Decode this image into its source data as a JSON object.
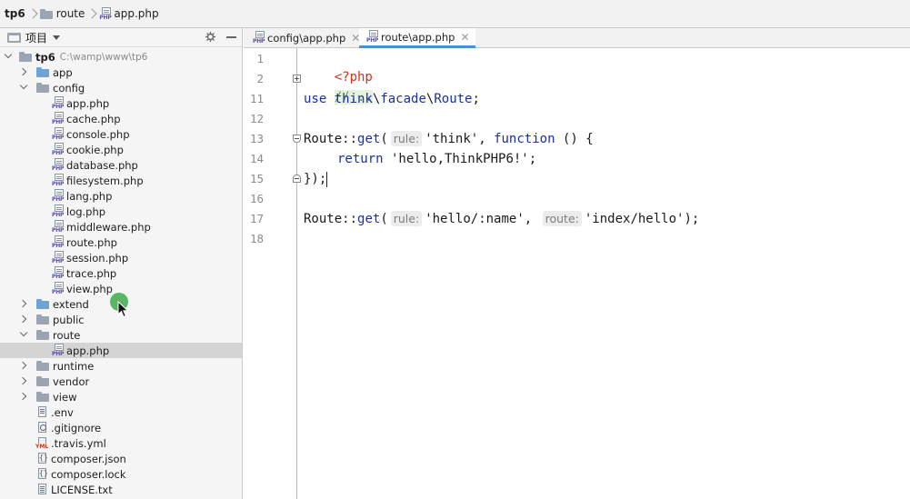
{
  "breadcrumb": {
    "root": "tp6",
    "folder": "route",
    "file": "app.php"
  },
  "project_panel": {
    "title": "项目",
    "root_name": "tp6",
    "root_path": "C:\\wamp\\www\\tp6",
    "tree": [
      {
        "label": "app",
        "kind": "folder",
        "expanded": false,
        "color": "#6ea3d8"
      },
      {
        "label": "config",
        "kind": "folder",
        "expanded": true,
        "color": "#9aa5b1"
      },
      {
        "label": "app.php",
        "kind": "php"
      },
      {
        "label": "cache.php",
        "kind": "php"
      },
      {
        "label": "console.php",
        "kind": "php"
      },
      {
        "label": "cookie.php",
        "kind": "php"
      },
      {
        "label": "database.php",
        "kind": "php"
      },
      {
        "label": "filesystem.php",
        "kind": "php"
      },
      {
        "label": "lang.php",
        "kind": "php"
      },
      {
        "label": "log.php",
        "kind": "php"
      },
      {
        "label": "middleware.php",
        "kind": "php"
      },
      {
        "label": "route.php",
        "kind": "php"
      },
      {
        "label": "session.php",
        "kind": "php"
      },
      {
        "label": "trace.php",
        "kind": "php"
      },
      {
        "label": "view.php",
        "kind": "php"
      },
      {
        "label": "extend",
        "kind": "folder",
        "expanded": false,
        "color": "#6ea3d8"
      },
      {
        "label": "public",
        "kind": "folder",
        "expanded": false,
        "color": "#9aa5b1"
      },
      {
        "label": "route",
        "kind": "folder",
        "expanded": true,
        "color": "#9aa5b1"
      },
      {
        "label": "app.php",
        "kind": "php",
        "selected": true
      },
      {
        "label": "runtime",
        "kind": "folder",
        "expanded": false,
        "color": "#9aa5b1"
      },
      {
        "label": "vendor",
        "kind": "folder",
        "expanded": false,
        "color": "#9aa5b1"
      },
      {
        "label": "view",
        "kind": "folder",
        "expanded": false,
        "color": "#9aa5b1"
      },
      {
        "label": ".env",
        "kind": "env"
      },
      {
        "label": ".gitignore",
        "kind": "git"
      },
      {
        "label": ".travis.yml",
        "kind": "yml"
      },
      {
        "label": "composer.json",
        "kind": "json"
      },
      {
        "label": "composer.lock",
        "kind": "json"
      },
      {
        "label": "LICENSE.txt",
        "kind": "txt"
      }
    ]
  },
  "tabs": [
    {
      "label": "config\\app.php",
      "active": false
    },
    {
      "label": "route\\app.php",
      "active": true
    }
  ],
  "icon_text": {
    "php": "PHP"
  },
  "editor": {
    "line_numbers": [
      "1",
      "2",
      "11",
      "12",
      "13",
      "14",
      "15",
      "16",
      "17",
      "18"
    ],
    "lines": {
      "l1": "<?php",
      "l2": "//...",
      "l11_use": "use",
      "l11_a": "think",
      "l11_s1": "\\",
      "l11_b": "facade",
      "l11_s2": "\\",
      "l11_c": "Route",
      "l11_end": ";",
      "l13_a": "Route::",
      "l13_get": "get",
      "l13_p": "(",
      "l13_hint": "rule:",
      "l13_str": "'think'",
      "l13_comma": ", ",
      "l13_fn": "function",
      "l13_end": " () {",
      "l14_ret": "return",
      "l14_str": " 'hello,ThinkPHP6!'",
      "l14_end": ";",
      "l15": "});",
      "l17_a": "Route::",
      "l17_get": "get",
      "l17_p": "(",
      "l17_hint1": "rule:",
      "l17_str1": "'hello/:name'",
      "l17_comma": ", ",
      "l17_hint2": "route:",
      "l17_str2": "'index/hello'",
      "l17_end": ");"
    }
  },
  "colors": {
    "selection": "#d4d4d4",
    "tab_active_underline": "#4c8ed9",
    "keyword": "#1a2fa8",
    "php_tag": "#d2311a",
    "comment": "#6c8f5a",
    "cursor_highlight": "#3daa4a"
  }
}
